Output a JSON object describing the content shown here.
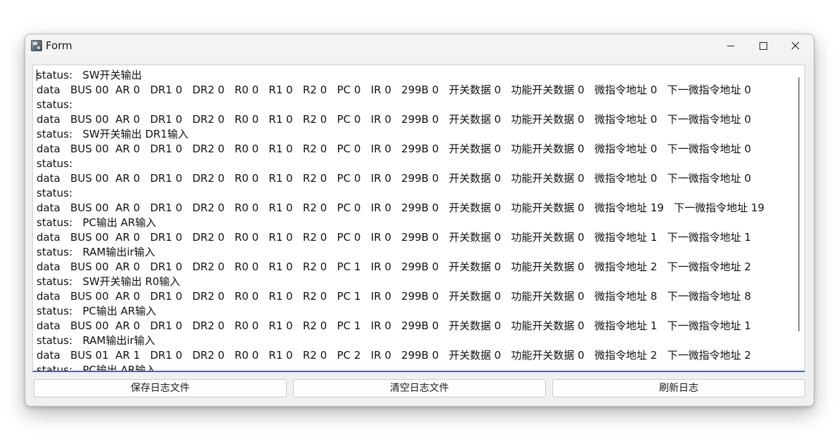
{
  "window": {
    "title": "Form"
  },
  "log": {
    "lines": [
      "status:   SW开关输出",
      "data   BUS 00  AR 0   DR1 0   DR2 0   R0 0   R1 0   R2 0   PC 0   IR 0   299B 0   开关数据 0   功能开关数据 0   微指令地址 0   下一微指令地址 0",
      "status:",
      "data   BUS 00  AR 0   DR1 0   DR2 0   R0 0   R1 0   R2 0   PC 0   IR 0   299B 0   开关数据 0   功能开关数据 0   微指令地址 0   下一微指令地址 0",
      "status:   SW开关输出 DR1输入",
      "data   BUS 00  AR 0   DR1 0   DR2 0   R0 0   R1 0   R2 0   PC 0   IR 0   299B 0   开关数据 0   功能开关数据 0   微指令地址 0   下一微指令地址 0",
      "status:",
      "data   BUS 00  AR 0   DR1 0   DR2 0   R0 0   R1 0   R2 0   PC 0   IR 0   299B 0   开关数据 0   功能开关数据 0   微指令地址 0   下一微指令地址 0",
      "status:",
      "data   BUS 00  AR 0   DR1 0   DR2 0   R0 0   R1 0   R2 0   PC 0   IR 0   299B 0   开关数据 0   功能开关数据 0   微指令地址 19   下一微指令地址 19",
      "status:   PC输出 AR输入",
      "data   BUS 00  AR 0   DR1 0   DR2 0   R0 0   R1 0   R2 0   PC 0   IR 0   299B 0   开关数据 0   功能开关数据 0   微指令地址 1   下一微指令地址 1",
      "status:   RAM输出ir输入",
      "data   BUS 00  AR 0   DR1 0   DR2 0   R0 0   R1 0   R2 0   PC 1   IR 0   299B 0   开关数据 0   功能开关数据 0   微指令地址 2   下一微指令地址 2",
      "status:   SW开关输出 R0输入",
      "data   BUS 00  AR 0   DR1 0   DR2 0   R0 0   R1 0   R2 0   PC 1   IR 0   299B 0   开关数据 0   功能开关数据 0   微指令地址 8   下一微指令地址 8",
      "status:   PC输出 AR输入",
      "data   BUS 00  AR 0   DR1 0   DR2 0   R0 0   R1 0   R2 0   PC 1   IR 0   299B 0   开关数据 0   功能开关数据 0   微指令地址 1   下一微指令地址 1",
      "status:   RAM输出ir输入",
      "data   BUS 01  AR 1   DR1 0   DR2 0   R0 0   R1 0   R2 0   PC 2   IR 0   299B 0   开关数据 0   功能开关数据 0   微指令地址 2   下一微指令地址 2",
      "status:   PC输出 AR输入"
    ]
  },
  "buttons": {
    "save_label": "保存日志文件",
    "clear_label": "清空日志文件",
    "refresh_label": "刷新日志"
  }
}
